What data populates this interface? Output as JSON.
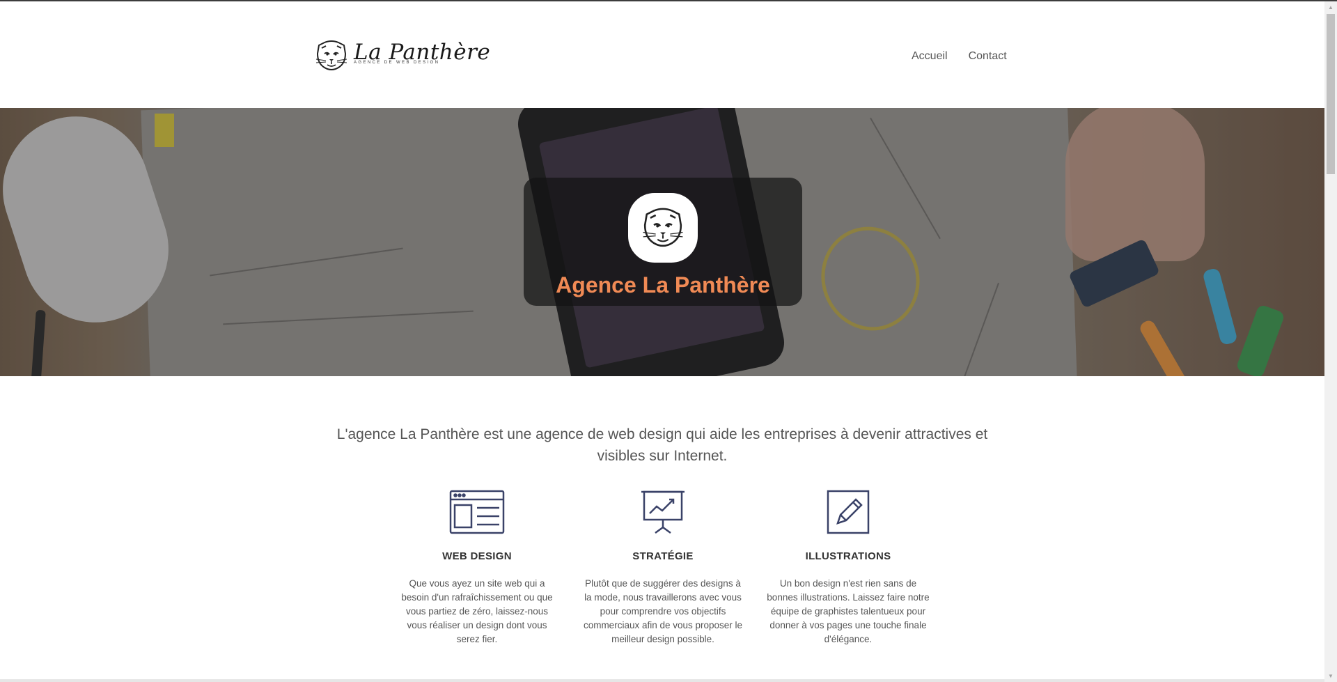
{
  "brand": {
    "name": "La Panthère",
    "tagline": "AGENCE DE WEB DESIGN"
  },
  "nav": {
    "items": [
      "Accueil",
      "Contact"
    ]
  },
  "hero": {
    "title": "Agence La Panthère"
  },
  "intro": {
    "text": "L'agence La Panthère est une agence de web design qui aide les entreprises à devenir attractives et visibles sur Internet."
  },
  "features": [
    {
      "icon": "webpage-icon",
      "title": "WEB DESIGN",
      "text": "Que vous ayez un site web qui a besoin d'un rafraîchissement ou que vous partiez de zéro, laissez-nous vous réaliser un design dont vous serez fier."
    },
    {
      "icon": "presentation-chart-icon",
      "title": "STRATÉGIE",
      "text": "Plutôt que de suggérer des designs à la mode, nous travaillerons avec vous pour comprendre vos objectifs commerciaux afin de vous proposer le meilleur design possible."
    },
    {
      "icon": "pencil-square-icon",
      "title": "ILLUSTRATIONS",
      "text": "Un bon design n'est rien sans de bonnes illustrations. Laissez faire notre équipe de graphistes talentueux pour donner à vos pages une touche finale d'élégance."
    }
  ],
  "colors": {
    "accent": "#f08a55",
    "icon": "#3a4268",
    "text": "#555555"
  }
}
